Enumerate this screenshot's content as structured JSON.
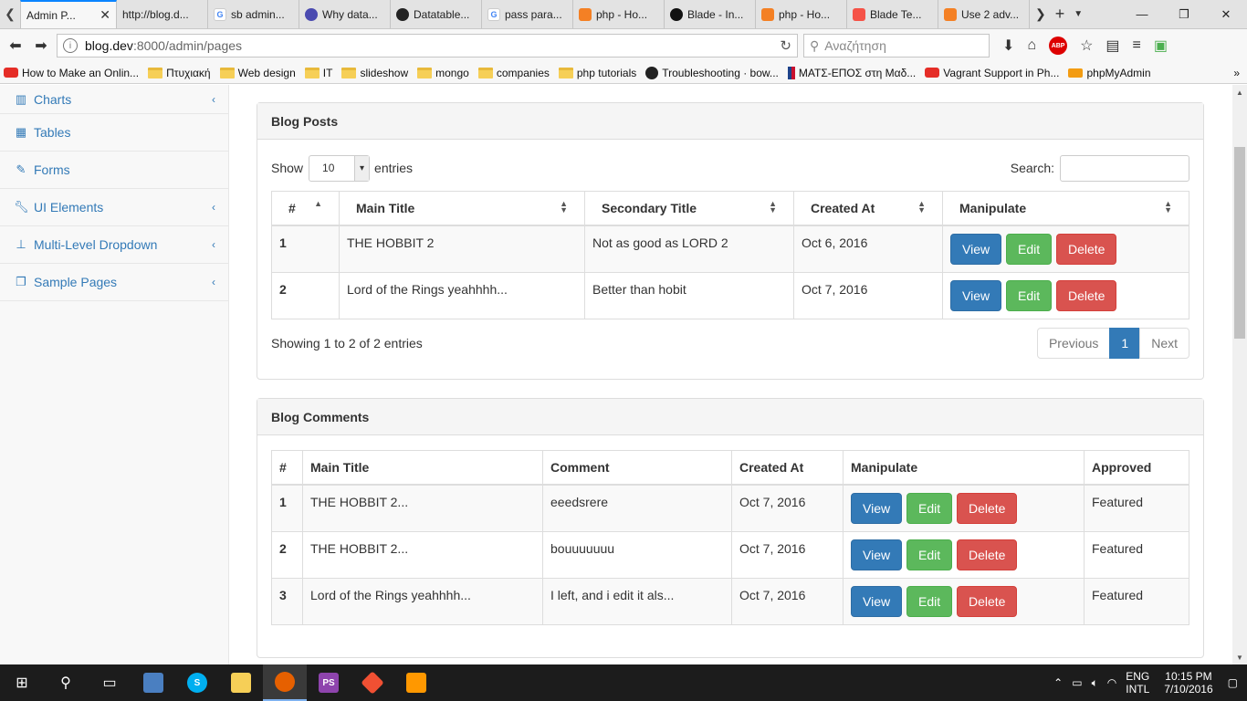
{
  "browser": {
    "tabs": [
      {
        "title": "Admin P...",
        "active": true,
        "icon": "admin-favicon"
      },
      {
        "title": "http://blog.d...",
        "icon": "blank-favicon"
      },
      {
        "title": "sb admin...",
        "icon": "google-favicon"
      },
      {
        "title": "Why data...",
        "icon": "globe-favicon"
      },
      {
        "title": "Datatable...",
        "icon": "github-favicon"
      },
      {
        "title": "pass para...",
        "icon": "google-favicon"
      },
      {
        "title": "php - Ho...",
        "icon": "stackoverflow-favicon"
      },
      {
        "title": "Blade - In...",
        "icon": "blade-favicon"
      },
      {
        "title": "php - Ho...",
        "icon": "stackoverflow-favicon"
      },
      {
        "title": "Blade Te...",
        "icon": "laravel-favicon"
      },
      {
        "title": "Use 2 adv...",
        "icon": "stackoverflow-favicon"
      }
    ],
    "url_host": "blog.dev",
    "url_rest": ":8000/admin/pages",
    "search_placeholder": "Αναζήτηση",
    "abp_label": "ABP",
    "bookmarks": [
      {
        "label": "How to Make an Onlin...",
        "icon": "youtube-icon"
      },
      {
        "label": "Πτυχιακή",
        "icon": "folder-icon"
      },
      {
        "label": "Web design",
        "icon": "folder-icon"
      },
      {
        "label": "IT",
        "icon": "folder-icon"
      },
      {
        "label": "slideshow",
        "icon": "folder-icon"
      },
      {
        "label": "mongo",
        "icon": "folder-icon"
      },
      {
        "label": "companies",
        "icon": "folder-icon"
      },
      {
        "label": "php tutorials",
        "icon": "folder-icon"
      },
      {
        "label": "Troubleshooting · bow...",
        "icon": "github-icon"
      },
      {
        "label": "ΜΑΤΣ-ΕΠΟΣ στη Μαδ...",
        "icon": "nba-icon"
      },
      {
        "label": "Vagrant Support in Ph...",
        "icon": "youtube-icon"
      },
      {
        "label": "phpMyAdmin",
        "icon": "phpmyadmin-icon"
      }
    ]
  },
  "sidebar": {
    "items": [
      {
        "label": "Charts",
        "icon": "bar-chart-icon",
        "has_arrow": true
      },
      {
        "label": "Tables",
        "icon": "table-icon",
        "has_arrow": false
      },
      {
        "label": "Forms",
        "icon": "edit-icon",
        "has_arrow": false
      },
      {
        "label": "UI Elements",
        "icon": "wrench-icon",
        "has_arrow": true
      },
      {
        "label": "Multi-Level Dropdown",
        "icon": "sitemap-icon",
        "has_arrow": true
      },
      {
        "label": "Sample Pages",
        "icon": "files-icon",
        "has_arrow": true
      }
    ]
  },
  "posts_panel": {
    "title": "Blog Posts",
    "show_label": "Show",
    "page_size": "10",
    "entries_label": "entries",
    "search_label": "Search:",
    "columns": [
      "#",
      "Main Title",
      "Secondary Title",
      "Created At",
      "Manipulate"
    ],
    "rows": [
      {
        "id": "1",
        "main_title": "THE HOBBIT 2",
        "secondary_title": "Not as good as LORD 2",
        "created_at": "Oct 6, 2016"
      },
      {
        "id": "2",
        "main_title": "Lord of the Rings yeahhhh...",
        "secondary_title": "Better than hobit",
        "created_at": "Oct 7, 2016"
      }
    ],
    "info": "Showing 1 to 2 of 2 entries",
    "pagination": {
      "previous": "Previous",
      "current": "1",
      "next": "Next"
    }
  },
  "comments_panel": {
    "title": "Blog Comments",
    "columns": [
      "#",
      "Main Title",
      "Comment",
      "Created At",
      "Manipulate",
      "Approved"
    ],
    "rows": [
      {
        "id": "1",
        "main_title": "THE HOBBIT 2...",
        "comment": "eeedsrere",
        "created_at": "Oct 7, 2016",
        "approved": "Featured"
      },
      {
        "id": "2",
        "main_title": "THE HOBBIT 2...",
        "comment": "bouuuuuuu",
        "created_at": "Oct 7, 2016",
        "approved": "Featured"
      },
      {
        "id": "3",
        "main_title": "Lord of the Rings yeahhhh...",
        "comment": "I left, and i edit it als...",
        "created_at": "Oct 7, 2016",
        "approved": "Featured"
      }
    ]
  },
  "buttons": {
    "view": "View",
    "edit": "Edit",
    "delete": "Delete"
  },
  "taskbar": {
    "lang_top": "ENG",
    "lang_bottom": "INTL",
    "time": "10:15 PM",
    "date": "7/10/2016"
  },
  "colors": {
    "primary": "#337ab7",
    "success": "#5cb85c",
    "danger": "#d9534f"
  }
}
